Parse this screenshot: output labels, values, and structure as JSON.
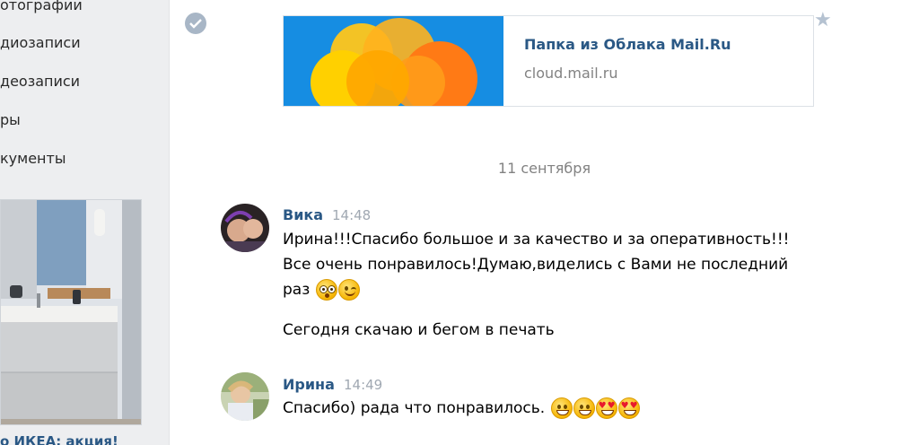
{
  "sidebar": {
    "items": [
      {
        "label": "отографии"
      },
      {
        "label": "диозаписи"
      },
      {
        "label": "деозаписи"
      },
      {
        "label": "ры"
      },
      {
        "label": "кументы"
      }
    ],
    "ad_title": "о ИКЕА: акция!"
  },
  "link_card": {
    "title": "Папка из Облака Mail.Ru",
    "url": "cloud.mail.ru"
  },
  "date_separator": "11 сентября",
  "messages": [
    {
      "author": "Вика",
      "time": "14:48",
      "lines": [
        "Ирина!!!Спасибо большое и за качество и за оперативность!!!",
        "Все очень понравилось!Думаю,виделись с Вами не последний",
        "раз"
      ],
      "emojis": [
        "flushed-face-emoji",
        "winking-face-emoji"
      ],
      "extra_line": "Сегодня скачаю и бегом в печать"
    },
    {
      "author": "Ирина",
      "time": "14:49",
      "lines": [
        "Спасибо) рада что понравилось."
      ],
      "emojis": [
        "grinning-face-emoji",
        "grinning-face-emoji",
        "heart-eyes-emoji",
        "heart-eyes-emoji"
      ]
    }
  ],
  "colors": {
    "link": "#2a5885",
    "muted": "#828282",
    "sidebar_bg": "#edeef0"
  }
}
